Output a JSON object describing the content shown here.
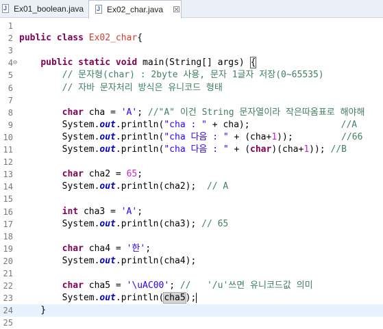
{
  "tabs": [
    {
      "label": "Ex01_boolean.java",
      "active": false
    },
    {
      "label": "Ex02_char.java",
      "active": true,
      "close": "☒"
    }
  ],
  "lines": [
    {
      "n": "1",
      "t": []
    },
    {
      "n": "2",
      "t": [
        [
          "kw",
          "public "
        ],
        [
          "kw",
          "class "
        ],
        [
          "cls",
          "Ex02_char"
        ],
        [
          "",
          "{"
        ]
      ]
    },
    {
      "n": "3",
      "t": []
    },
    {
      "n": "4",
      "fold": "⊖",
      "t": [
        [
          "",
          "    "
        ],
        [
          "kw",
          "public "
        ],
        [
          "kw",
          "static "
        ],
        [
          "kw",
          "void "
        ],
        [
          "",
          "main(String[] args) "
        ],
        [
          "cur",
          "{"
        ]
      ]
    },
    {
      "n": "5",
      "t": [
        [
          "",
          "        "
        ],
        [
          "cm",
          "// 문자형(char) : 2byte 사용, 문자 1글자 저장(0~65535)"
        ]
      ]
    },
    {
      "n": "6",
      "t": [
        [
          "",
          "        "
        ],
        [
          "cm",
          "// 자바 문자처리 방식은 유니코드 형태"
        ]
      ]
    },
    {
      "n": "7",
      "t": []
    },
    {
      "n": "8",
      "t": [
        [
          "",
          "        "
        ],
        [
          "kw",
          "char "
        ],
        [
          "",
          "cha = "
        ],
        [
          "st",
          "'A'"
        ],
        [
          "",
          "; "
        ],
        [
          "cm",
          "//\"A\" 이건 String 문자열이라 작은따옴표로 해야해"
        ]
      ]
    },
    {
      "n": "9",
      "t": [
        [
          "",
          "        System."
        ],
        [
          "fld",
          "out"
        ],
        [
          "",
          ".println("
        ],
        [
          "st",
          "\"cha : \""
        ],
        [
          "",
          " + cha);"
        ],
        [
          "",
          "                 "
        ],
        [
          "cm",
          "//A"
        ]
      ]
    },
    {
      "n": "10",
      "t": [
        [
          "",
          "        System."
        ],
        [
          "fld",
          "out"
        ],
        [
          "",
          ".println("
        ],
        [
          "st",
          "\"cha 다음 : \""
        ],
        [
          "",
          " + (cha+"
        ],
        [
          "nm",
          "1"
        ],
        [
          "",
          "));"
        ],
        [
          "",
          "         "
        ],
        [
          "cm",
          "//66"
        ]
      ]
    },
    {
      "n": "11",
      "t": [
        [
          "",
          "        System."
        ],
        [
          "fld",
          "out"
        ],
        [
          "",
          ".println("
        ],
        [
          "st",
          "\"cha 다음 : \""
        ],
        [
          "",
          " + ("
        ],
        [
          "kw",
          "char"
        ],
        [
          "",
          ")(cha+"
        ],
        [
          "nm",
          "1"
        ],
        [
          "",
          ")); "
        ],
        [
          "cm",
          "//B"
        ]
      ]
    },
    {
      "n": "12",
      "t": []
    },
    {
      "n": "13",
      "t": [
        [
          "",
          "        "
        ],
        [
          "kw",
          "char "
        ],
        [
          "",
          "cha2 = "
        ],
        [
          "nm",
          "65"
        ],
        [
          "",
          ";"
        ]
      ]
    },
    {
      "n": "14",
      "t": [
        [
          "",
          "        System."
        ],
        [
          "fld",
          "out"
        ],
        [
          "",
          ".println(cha2);  "
        ],
        [
          "cm",
          "// A"
        ]
      ]
    },
    {
      "n": "15",
      "t": []
    },
    {
      "n": "16",
      "t": [
        [
          "",
          "        "
        ],
        [
          "kw",
          "int "
        ],
        [
          "",
          "cha3 = "
        ],
        [
          "st",
          "'A'"
        ],
        [
          "",
          ";"
        ]
      ]
    },
    {
      "n": "17",
      "t": [
        [
          "",
          "        System."
        ],
        [
          "fld",
          "out"
        ],
        [
          "",
          ".println(cha3); "
        ],
        [
          "cm",
          "// 65"
        ]
      ]
    },
    {
      "n": "18",
      "t": []
    },
    {
      "n": "19",
      "t": [
        [
          "",
          "        "
        ],
        [
          "kw",
          "char "
        ],
        [
          "",
          "cha4 = "
        ],
        [
          "st",
          "'한'"
        ],
        [
          "",
          ";"
        ]
      ]
    },
    {
      "n": "20",
      "t": [
        [
          "",
          "        System."
        ],
        [
          "fld",
          "out"
        ],
        [
          "",
          ".println(cha4);"
        ]
      ]
    },
    {
      "n": "21",
      "t": []
    },
    {
      "n": "22",
      "t": [
        [
          "",
          "        "
        ],
        [
          "kw",
          "char "
        ],
        [
          "",
          "cha5 = "
        ],
        [
          "st",
          "'\\uAC00'"
        ],
        [
          "",
          "; "
        ],
        [
          "cm",
          "//   '/u'쓰면 유니코드값 의미"
        ]
      ]
    },
    {
      "n": "23",
      "t": [
        [
          "",
          "        System."
        ],
        [
          "fld",
          "out"
        ],
        [
          "",
          ".println("
        ],
        [
          "hl",
          "cha5"
        ],
        [
          "caret",
          ");"
        ]
      ]
    },
    {
      "n": "24",
      "current": true,
      "t": [
        [
          "",
          "    }"
        ]
      ]
    },
    {
      "n": "25",
      "t": []
    }
  ],
  "colors": {
    "keyword": "#7f0055",
    "comment": "#3f7f5f",
    "string": "#2a00ff",
    "field": "#0000c0",
    "number": "#cc22cc",
    "current_line": "#e8f2fe"
  }
}
